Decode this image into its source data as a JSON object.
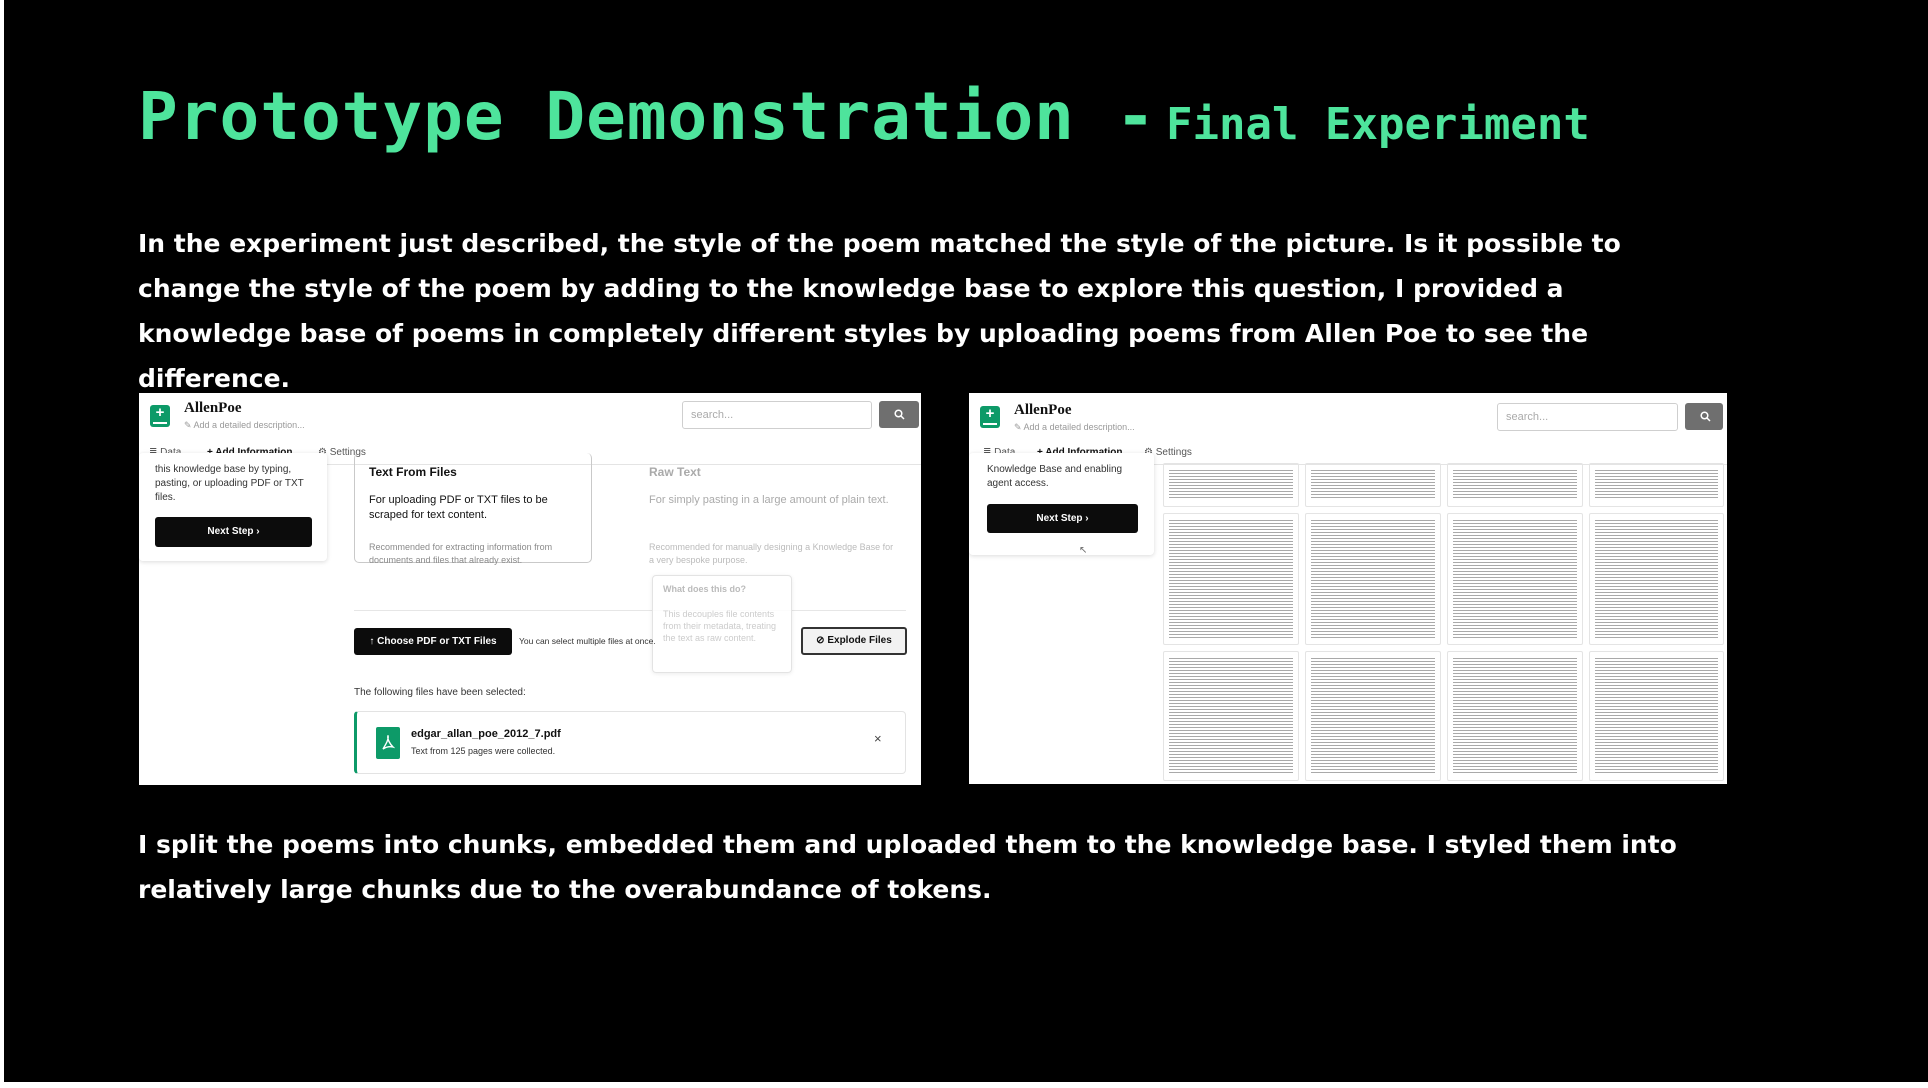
{
  "slide": {
    "title_main": "Prototype Demonstration -",
    "title_sub": "Final Experiment",
    "intro": "In the experiment just described, the style of the poem matched the style of the picture. Is it possible to change the style of the poem by adding to the knowledge base to explore this question, I provided a knowledge base of poems in completely different styles by uploading poems from Allen Poe to see the difference.",
    "outro": "I split the poems into chunks, embedded them and uploaded them to the knowledge base. I styled them into relatively large chunks due to the overabundance of tokens."
  },
  "colors": {
    "title": "#4ee49c",
    "background": "#000000",
    "accent": "#0d9a68"
  },
  "app": {
    "name": "AllenPoe",
    "description_placeholder": "Add a detailed description...",
    "search_placeholder": "search...",
    "tabs": {
      "data": "Data",
      "add_information": "Add Information",
      "settings": "Settings"
    }
  },
  "left_shot": {
    "sidebar_text": "this knowledge base by typing, pasting, or uploading PDF or TXT files.",
    "next_step": "Next Step",
    "text_from_files": {
      "heading": "Text From Files",
      "description": "For uploading PDF or TXT files to be scraped for text content.",
      "note": "Recommended for extracting information from documents and files that already exist."
    },
    "raw_text": {
      "heading": "Raw Text",
      "description": "For simply pasting in a large amount of plain text.",
      "note": "Recommended for manually designing a Knowledge Base for a very bespoke purpose."
    },
    "tooltip": {
      "heading": "What does this do?",
      "body": "This decouples file contents from their metadata, treating the text as raw content."
    },
    "choose_button": "Choose PDF or TXT Files",
    "multi_note": "You can select multiple files at once.",
    "explode_button": "Explode Files",
    "selected_label": "The following files have been selected:",
    "file": {
      "name": "edgar_allan_poe_2012_7.pdf",
      "detail": "Text from 125 pages were collected."
    }
  },
  "right_shot": {
    "sidebar_text": "Knowledge Base and enabling agent access.",
    "next_step": "Next Step"
  },
  "icons": [
    "logo-icon",
    "edit-icon",
    "search-icon",
    "database-icon",
    "plus-icon",
    "gear-icon",
    "upload-icon",
    "layers-icon",
    "pdf-icon",
    "close-icon",
    "chevron-right-icon",
    "cursor-icon"
  ]
}
